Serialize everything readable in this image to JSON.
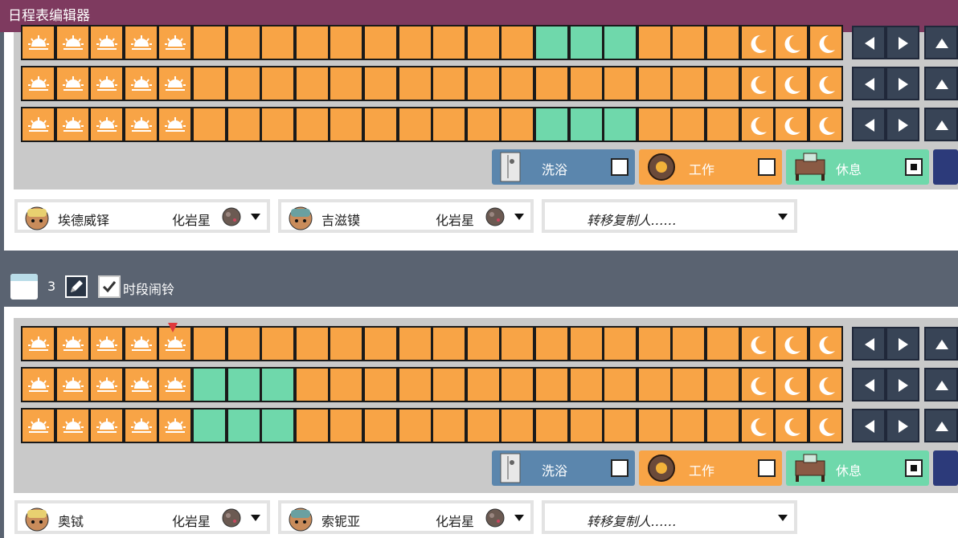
{
  "window": {
    "title": "日程表编辑器"
  },
  "legend": {
    "bath_label": "洗浴",
    "work_label": "工作",
    "rest_label": "休息",
    "selected": "rest"
  },
  "schedule_top": {
    "rows": [
      {
        "blocks": "sssssooooooooooRRRooooooommm"
      },
      {
        "blocks": "sssssooooooooooooooooooooommm"
      },
      {
        "blocks": "sssssooooooooooRRRooooooommm"
      }
    ],
    "dupes": [
      {
        "name": "埃德威铎",
        "planet": "化岩星"
      },
      {
        "name": "吉滋镆",
        "planet": "化岩星"
      }
    ],
    "copy_label": "转移复制人……"
  },
  "schedule_bottom": {
    "number": "3",
    "alarm_label": "时段闹铃",
    "alarm_checked": true,
    "rows": [
      {
        "blocks": "sssssooooooooooooooooooooommm"
      },
      {
        "blocks": "sssssRRRoooooooooooooooooommm"
      },
      {
        "blocks": "sssssRRRoooooooooooooooooommm"
      }
    ],
    "dupes": [
      {
        "name": "奥铽",
        "planet": "化岩星"
      },
      {
        "name": "索铌亚",
        "planet": "化岩星"
      }
    ],
    "copy_label": "转移复制人……"
  },
  "colors": {
    "work": "#f8a446",
    "rest": "#6fd8ab",
    "bath": "#5b86ad",
    "title_bar": "#7e3a5f",
    "header": "#5a6371"
  }
}
